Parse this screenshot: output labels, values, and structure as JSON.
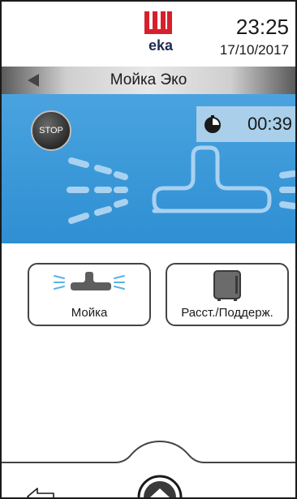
{
  "header": {
    "logo_text": "eka",
    "time": "23:25",
    "date": "17/10/2017"
  },
  "titlebar": {
    "title": "Мойка Эко",
    "back_icon": "triangle-left-icon"
  },
  "panel": {
    "stop_label": "STOP",
    "timer_value": "00:39",
    "timer_icon": "timer-icon",
    "colors": {
      "panel": "#2e8fd2",
      "timer_bg": "#a9cfea"
    }
  },
  "functions": [
    {
      "label": "Мойка",
      "icon": "wash-spray-icon"
    },
    {
      "label": "Расст./Поддерж.",
      "icon": "proofer-cabinet-icon"
    }
  ],
  "bottom": {
    "back_icon": "back-outline-arrow-icon",
    "home_icon": "home-icon"
  }
}
